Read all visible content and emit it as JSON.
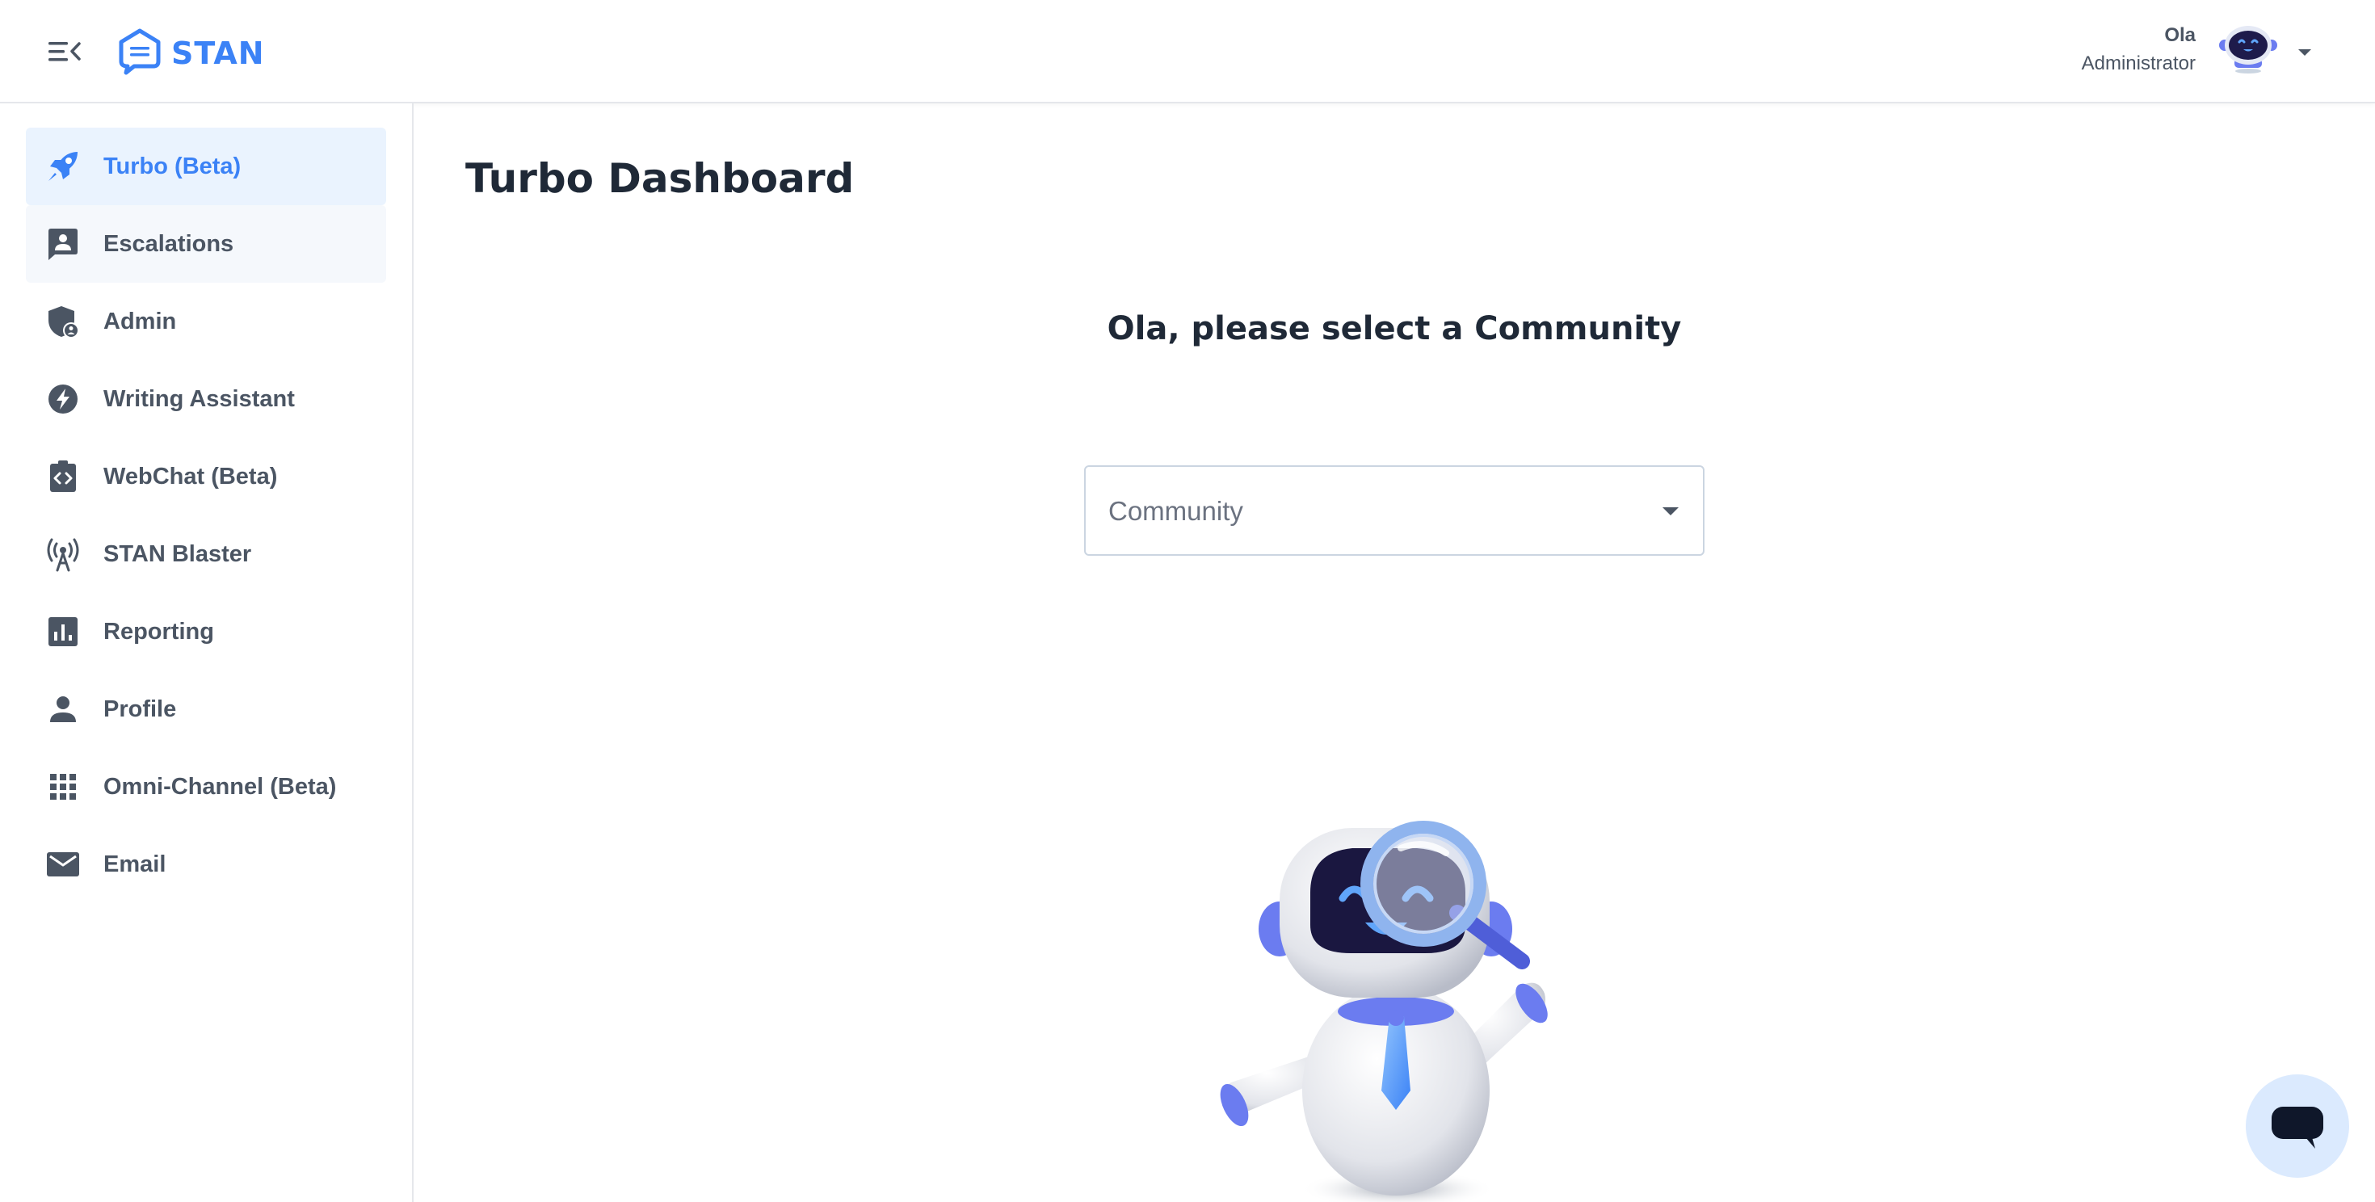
{
  "app": {
    "logo_text": "STAN"
  },
  "header": {
    "user_name": "Ola",
    "user_role": "Administrator",
    "icons": {
      "menu": "menu-collapse-icon",
      "avatar": "robot-avatar",
      "caret": "caret-down-icon"
    }
  },
  "sidebar": {
    "items": [
      {
        "label": "Turbo (Beta)",
        "icon": "rocket-icon",
        "state": "active"
      },
      {
        "label": "Escalations",
        "icon": "person-chat-icon",
        "state": "hover"
      },
      {
        "label": "Admin",
        "icon": "shield-user-icon"
      },
      {
        "label": "Writing Assistant",
        "icon": "bolt-icon"
      },
      {
        "label": "WebChat (Beta)",
        "icon": "code-clipboard-icon"
      },
      {
        "label": "STAN Blaster",
        "icon": "broadcast-tower-icon"
      },
      {
        "label": "Reporting",
        "icon": "bar-chart-icon"
      },
      {
        "label": "Profile",
        "icon": "person-icon"
      },
      {
        "label": "Omni-Channel (Beta)",
        "icon": "grid-icon"
      },
      {
        "label": "Email",
        "icon": "mail-icon"
      }
    ]
  },
  "main": {
    "title": "Turbo Dashboard",
    "prompt": "Ola, please select a Community",
    "community_select": {
      "value": "Community"
    }
  },
  "colors": {
    "accent": "#3b82f6",
    "active_bg": "#eaf3fe",
    "text": "#4b5563",
    "robot_blue": "#6b7cf0"
  }
}
